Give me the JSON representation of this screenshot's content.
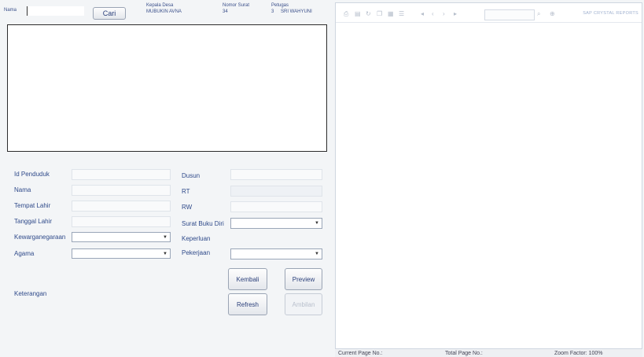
{
  "search": {
    "label": "Nama",
    "value": "",
    "button": "Cari"
  },
  "header": {
    "kepala_desa_label": "Kepala Desa",
    "kepala_desa_value": "MUBUKIN AVNA",
    "nomor_surat_label": "Nomor Surat",
    "nomor_surat_value": "34",
    "petugas_label": "Petugas",
    "petugas_id": "3",
    "petugas_name": "SRI WAHYUNI"
  },
  "form": {
    "id_penduduk": "Id Penduduk",
    "nama": "Nama",
    "tempat_lahir": "Tempat Lahir",
    "tanggal_lahir": "Tanggal Lahir",
    "kewarganegaraan": "Kewarganegaraan",
    "agama": "Agama",
    "keterangan": "Keterangan",
    "dusun": "Dusun",
    "rt": "RT",
    "rw": "RW",
    "surat_buku_diri": "Surat Buku Diri",
    "keperluan": "Keperluan",
    "pekerjaan": "Pekerjaan"
  },
  "buttons": {
    "kembali": "Kembali",
    "preview": "Preview",
    "refresh": "Refresh",
    "ambil": "Ambilan"
  },
  "report": {
    "brand": "SAP CRYSTAL REPORTS",
    "current_page": "Current Page No.:",
    "total_page": "Total Page No.:",
    "zoom": "Zoom Factor: 100%"
  },
  "icons": [
    "export-icon",
    "print-icon",
    "refresh-icon",
    "copy-icon",
    "group-tree-icon",
    "parameter-icon",
    "first-page-icon",
    "prev-page-icon",
    "next-page-icon",
    "last-page-icon",
    "find-icon",
    "zoom-icon"
  ]
}
